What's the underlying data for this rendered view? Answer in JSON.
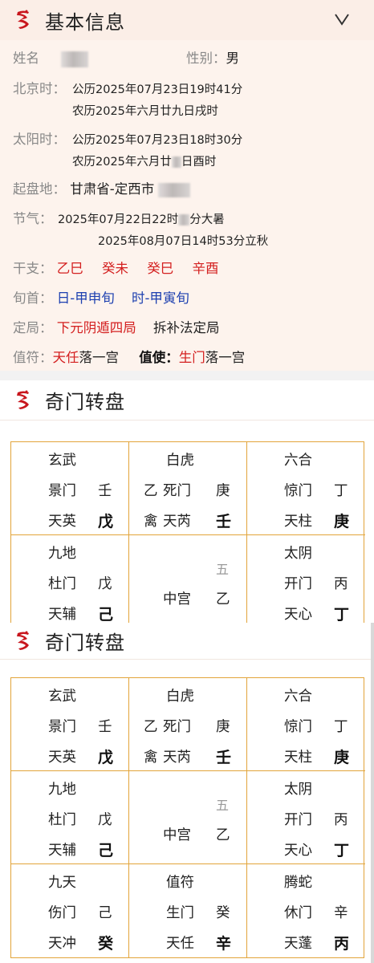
{
  "basic": {
    "title": "基本信息",
    "name_label": "姓名",
    "gender_label": "性别：",
    "gender_value": "男",
    "beijing_label": "北京时：",
    "beijing_solar": "公历2025年07月23日19时41分",
    "beijing_lunar": "农历2025年六月廿九日戌时",
    "solar_label": "太阳时：",
    "solar_solar": "公历2025年07月23日18时30分",
    "solar_lunar_a": "农历2025年六月廿",
    "solar_lunar_b": "日酉时",
    "place_label": "起盘地：",
    "place_value": "甘肃省-定西市",
    "jieqi_label": "节气：",
    "jieqi_line1_a": "2025年07月22日22时",
    "jieqi_line1_b": "分大暑",
    "jieqi_line2": "2025年08月07日14时53分立秋",
    "ganzhi_label": "干支：",
    "ganzhi": [
      "乙巳",
      "癸未",
      "癸巳",
      "辛酉"
    ],
    "xunshou_label": "旬首：",
    "xunshou": [
      "日-甲申旬",
      "时-甲寅旬"
    ],
    "dingju_label": "定局：",
    "dingju_value": "下元阴遁四局",
    "dingju_method": "拆补法定局",
    "zhifu_label": "值符：",
    "zhifu_star": "天任",
    "zhifu_text": "落一宫",
    "zhishi_label": "值使：",
    "zhishi_door": "生门",
    "zhishi_text": "落一宫"
  },
  "plate_title": "奇门转盘",
  "palaces": [
    {
      "god": "玄武",
      "door": "景门",
      "door_stem": "壬",
      "star": "天英",
      "star_stem": "戊"
    },
    {
      "god": "白虎",
      "pre": "乙",
      "door": "死门",
      "door_stem": "庚",
      "pre2": "禽",
      "star": "天芮",
      "star_stem": "壬"
    },
    {
      "god": "六合",
      "door": "惊门",
      "door_stem": "丁",
      "star": "天柱",
      "star_stem": "庚"
    },
    {
      "god": "九地",
      "door": "杜门",
      "door_stem": "戊",
      "star": "天辅",
      "star_stem": "己"
    },
    {
      "num": "五",
      "center": "中宫",
      "center_stem": "乙"
    },
    {
      "god": "太阴",
      "door": "开门",
      "door_stem": "丙",
      "star": "天心",
      "star_stem": "丁"
    },
    {
      "god": "九天",
      "door": "伤门",
      "door_stem": "己",
      "star": "天冲",
      "star_stem": "癸"
    },
    {
      "god": "值符",
      "door": "生门",
      "door_stem": "癸",
      "star": "天任",
      "star_stem": "辛"
    },
    {
      "god": "腾蛇",
      "door": "休门",
      "door_stem": "辛",
      "star": "天蓬",
      "star_stem": "丙"
    }
  ],
  "colors": {
    "accent_red": "#d42020",
    "accent_blue": "#1c3fb0",
    "grid_gold": "#e2a43a",
    "card_bg": "#fdf3ed"
  },
  "icons": {
    "logo": "dragon-logo-icon",
    "collapse": "chevron-down-icon"
  }
}
